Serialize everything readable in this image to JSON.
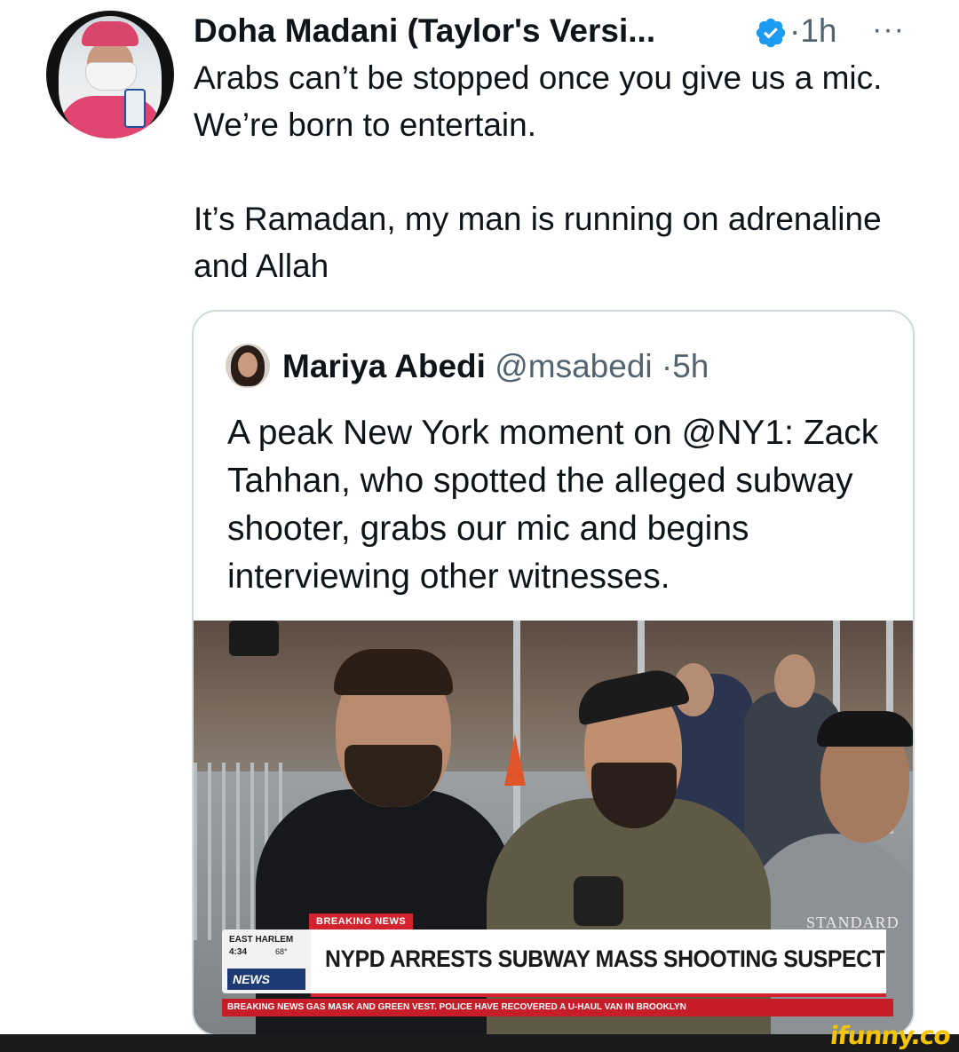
{
  "tweet": {
    "author_name": "Doha Madani (Taylor's Versi...",
    "verified_icon": "verified-badge-icon",
    "time_sep": "·",
    "time": "1h",
    "more_icon": "···",
    "text_p1": "Arabs can’t be stopped once you give us a mic. We’re born to entertain.",
    "text_p2": "It’s Ramadan, my man is running on adrenaline and Allah"
  },
  "quoted_tweet": {
    "author_name": "Mariya Abedi",
    "handle": "@msabedi",
    "time_sep": "·",
    "time": "5h",
    "text": "A peak New York moment on @NY1: Zack Tahhan, who spotted the alleged subway shooter, grabs our mic and begins interviewing other witnesses.",
    "media": {
      "breaking_label": "BREAKING NEWS",
      "location": "EAST HARLEM",
      "clock": "4:34",
      "temperature": "68°",
      "network": "NEWS",
      "headline": "NYPD ARRESTS SUBWAY MASS SHOOTING SUSPECT",
      "ticker": "BREAKING NEWS GAS MASK AND GREEN VEST. POLICE HAVE RECOVERED A U-HAUL VAN IN BROOKLYN",
      "sign_text": "STANDARD"
    }
  },
  "watermark": "ifunny.co",
  "colors": {
    "text_primary": "#0f1419",
    "text_secondary": "#536471",
    "verified_blue": "#1d9bf0",
    "card_border": "#cfd9de",
    "breaking_red": "#d2222d",
    "watermark_yellow": "#f5c400"
  }
}
